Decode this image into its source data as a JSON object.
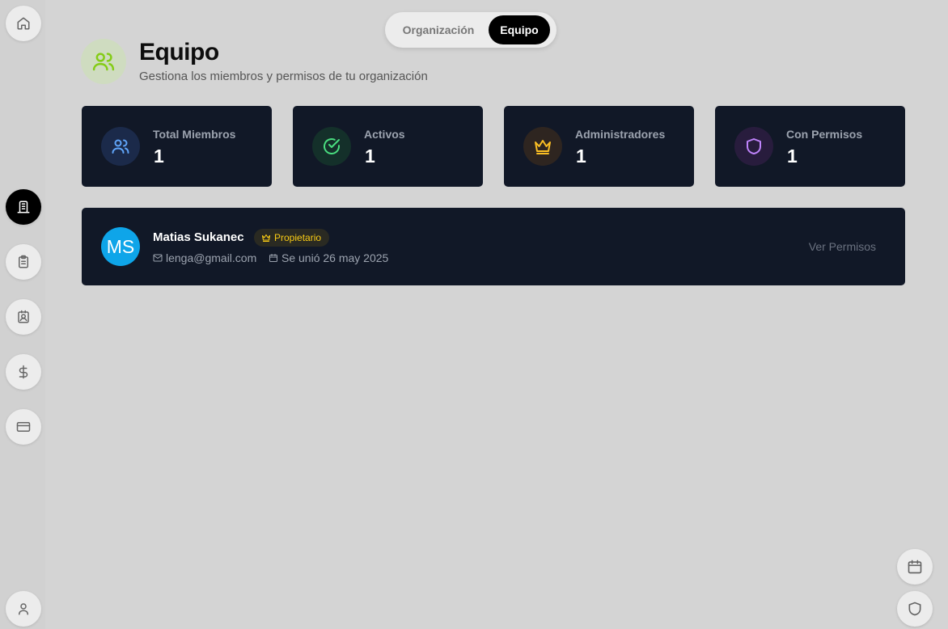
{
  "sidebar": {
    "items": [
      {
        "icon": "home-icon"
      },
      {
        "icon": "building-icon",
        "active": true
      },
      {
        "icon": "clipboard-icon"
      },
      {
        "icon": "contact-badge-icon"
      },
      {
        "icon": "dollar-icon"
      },
      {
        "icon": "credit-card-icon"
      },
      {
        "icon": "user-icon"
      }
    ]
  },
  "tabs": {
    "items": [
      "Organización",
      "Equipo"
    ],
    "selected": "Equipo"
  },
  "header": {
    "title": "Equipo",
    "subtitle": "Gestiona los miembros y permisos de tu organización",
    "icon": "users-icon",
    "icon_color": "#84cc16"
  },
  "stats": [
    {
      "label": "Total Miembros",
      "value": "1",
      "icon": "users-icon",
      "color": "#60a5fa"
    },
    {
      "label": "Activos",
      "value": "1",
      "icon": "check-circle-icon",
      "color": "#4ade80"
    },
    {
      "label": "Administradores",
      "value": "1",
      "icon": "crown-icon",
      "color": "#fbbf24"
    },
    {
      "label": "Con Permisos",
      "value": "1",
      "icon": "shield-icon",
      "color": "#c084fc"
    }
  ],
  "members": [
    {
      "initials": "MS",
      "name": "Matias Sukanec",
      "role": "Propietario",
      "email": "lenga@gmail.com",
      "joined": "Se unió 26 may 2025",
      "action": "Ver Permisos"
    }
  ],
  "floating": [
    {
      "icon": "calendar-icon"
    },
    {
      "icon": "shield-icon"
    }
  ],
  "colors": {
    "background": "#d4d4d4",
    "card": "#111827",
    "accent_badge": "#facc15",
    "avatar": "#0ea5e9"
  }
}
